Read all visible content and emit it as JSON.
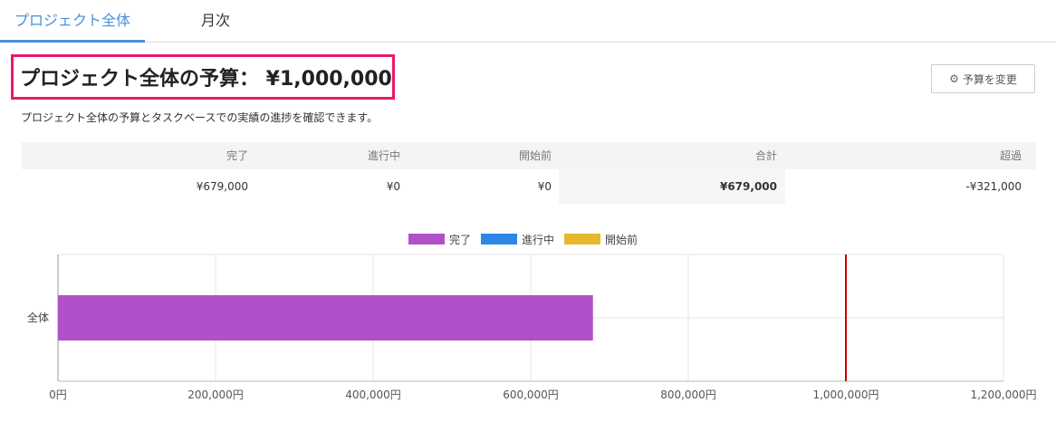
{
  "tabs": [
    {
      "label": "プロジェクト全体",
      "active": true
    },
    {
      "label": "月次",
      "active": false
    }
  ],
  "header": {
    "title": "プロジェクト全体の予算： ¥1,000,000",
    "budget_button_label": "予算を変更",
    "description": "プロジェクト全体の予算とタスクベースでの実績の進捗を確認できます。"
  },
  "summary_table": {
    "headers": [
      "完了",
      "進行中",
      "開始前",
      "合計",
      "超過"
    ],
    "values": [
      "¥679,000",
      "¥0",
      "¥0",
      "¥679,000",
      "-¥321,000"
    ]
  },
  "colors": {
    "accent": "#4a90d9",
    "highlight_border": "#e8196c",
    "completed": "#b150c9",
    "in_progress": "#2e86e6",
    "not_started": "#e6b82e",
    "budget_line": "#cc0000"
  },
  "chart_data": {
    "type": "bar",
    "orientation": "horizontal",
    "stacked": true,
    "categories": [
      "全体"
    ],
    "series": [
      {
        "name": "完了",
        "values": [
          679000
        ]
      },
      {
        "name": "進行中",
        "values": [
          0
        ]
      },
      {
        "name": "開始前",
        "values": [
          0
        ]
      }
    ],
    "xlim": [
      0,
      1200000
    ],
    "xticks": [
      0,
      200000,
      400000,
      600000,
      800000,
      1000000,
      1200000
    ],
    "xtick_labels": [
      "0円",
      "200,000円",
      "400,000円",
      "600,000円",
      "800,000円",
      "1,000,000円",
      "1,200,000円"
    ],
    "budget_marker": 1000000,
    "grid": true,
    "legend_position": "top"
  }
}
